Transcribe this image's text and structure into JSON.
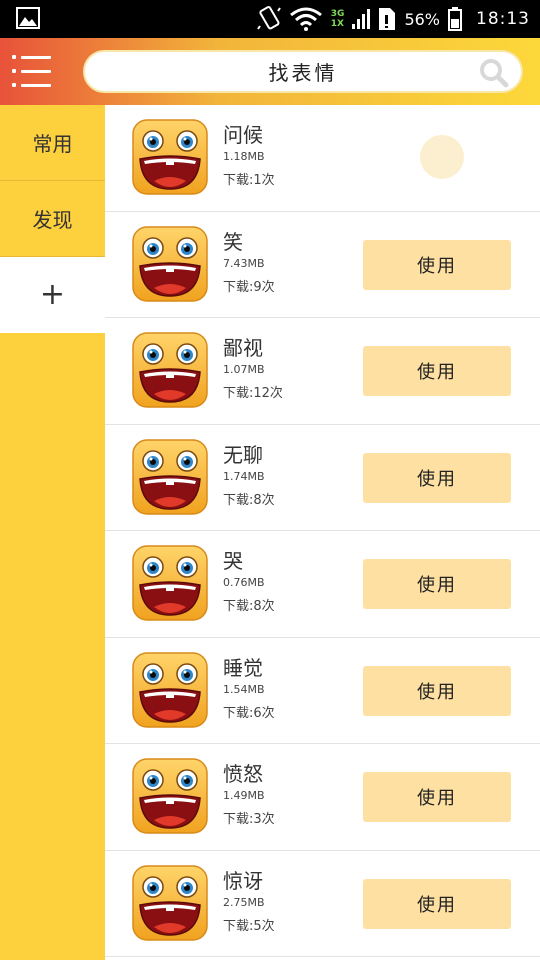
{
  "status_bar": {
    "network_type_top": "3G",
    "network_type_bottom": "1X",
    "battery_percent": "56%",
    "time": "18:13"
  },
  "header": {
    "search_label": "找表情"
  },
  "sidebar": {
    "items": [
      {
        "label": "常用"
      },
      {
        "label": "发现"
      }
    ],
    "add_label": "+"
  },
  "list": {
    "use_button_label": "使用",
    "items": [
      {
        "name": "问候",
        "size": "1.18MB",
        "downloads": "下载:1次",
        "state": "loading"
      },
      {
        "name": "笑",
        "size": "7.43MB",
        "downloads": "下载:9次",
        "state": "use"
      },
      {
        "name": "鄙视",
        "size": "1.07MB",
        "downloads": "下载:12次",
        "state": "use"
      },
      {
        "name": "无聊",
        "size": "1.74MB",
        "downloads": "下载:8次",
        "state": "use"
      },
      {
        "name": "哭",
        "size": "0.76MB",
        "downloads": "下载:8次",
        "state": "use"
      },
      {
        "name": "睡觉",
        "size": "1.54MB",
        "downloads": "下载:6次",
        "state": "use"
      },
      {
        "name": "愤怒",
        "size": "1.49MB",
        "downloads": "下载:3次",
        "state": "use"
      },
      {
        "name": "惊讶",
        "size": "2.75MB",
        "downloads": "下载:5次",
        "state": "use"
      }
    ]
  },
  "colors": {
    "sidebar_bg": "#fdd13e",
    "use_button_bg": "#fde0a2",
    "header_gradient_start": "#e8523a",
    "header_gradient_end": "#fcd83a"
  },
  "icons": {
    "menu": "menu-icon",
    "search": "search-icon",
    "emoji": "emoji-face-icon",
    "gallery": "gallery-icon"
  }
}
